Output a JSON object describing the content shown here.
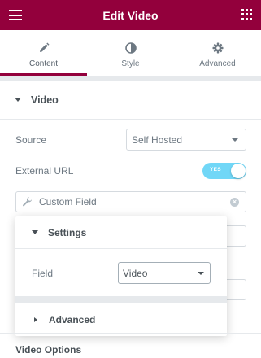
{
  "header": {
    "title": "Edit Video",
    "menu_icon": "hamburger-icon",
    "apps_icon": "grid-icon"
  },
  "tabs": [
    {
      "label": "Content",
      "icon": "pencil-icon",
      "active": true
    },
    {
      "label": "Style",
      "icon": "contrast-icon",
      "active": false
    },
    {
      "label": "Advanced",
      "icon": "gear-icon",
      "active": false
    }
  ],
  "section": {
    "title": "Video"
  },
  "controls": {
    "source": {
      "label": "Source",
      "value": "Self Hosted"
    },
    "external_url": {
      "label": "External URL",
      "toggle_text": "YES",
      "on": true
    },
    "dynamic": {
      "value": "Custom Field"
    }
  },
  "popover": {
    "settings_title": "Settings",
    "field_label": "Field",
    "field_value": "Video",
    "advanced_title": "Advanced"
  },
  "footer": {
    "title": "Video Options"
  },
  "colors": {
    "brand": "#93003c",
    "toggle": "#71d7f7"
  }
}
